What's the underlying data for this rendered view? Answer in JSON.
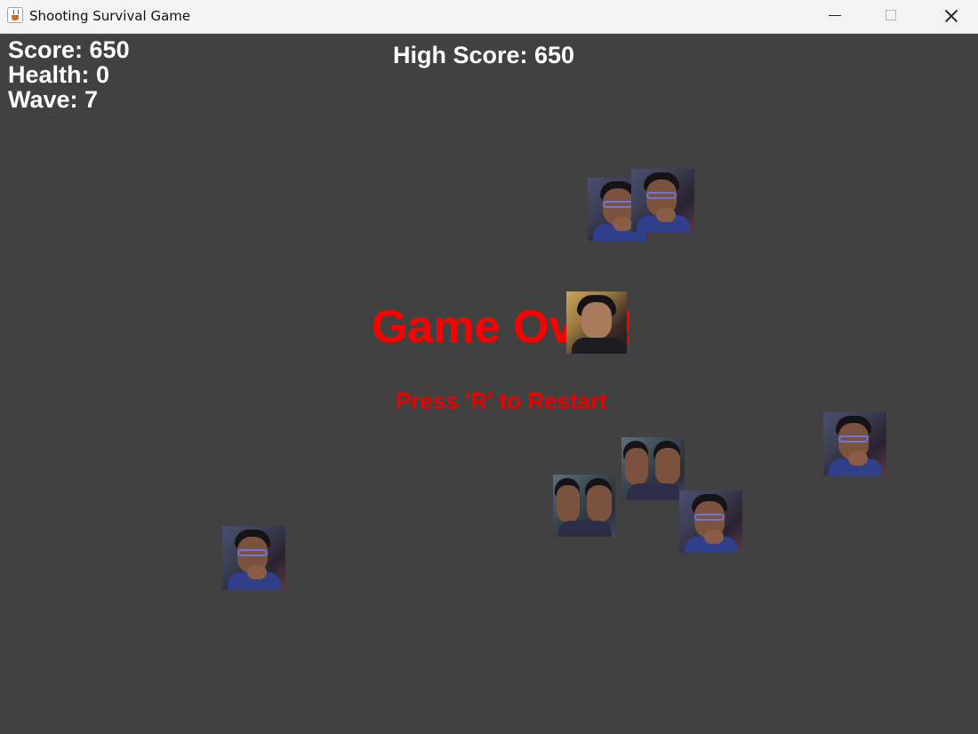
{
  "window": {
    "title": "Shooting Survival Game"
  },
  "hud": {
    "score": "Score: 650",
    "health": "Health: 0",
    "wave": "Wave: 7",
    "high_score": "High Score: 650"
  },
  "overlay": {
    "game_over": "Game Over!",
    "restart_hint": "Press 'R' to Restart"
  },
  "enemies": [
    {
      "kind": "glasses-boy-photo"
    },
    {
      "kind": "glasses-boy-photo"
    },
    {
      "kind": "boy-photo"
    },
    {
      "kind": "glasses-boy-photo"
    },
    {
      "kind": "two-boys-photo"
    },
    {
      "kind": "two-boys-photo"
    },
    {
      "kind": "glasses-boy-photo"
    },
    {
      "kind": "glasses-boy-photo"
    }
  ],
  "colors": {
    "background": "#414141",
    "hud_text": "#ffffff",
    "game_over_text": "#ff0000"
  }
}
